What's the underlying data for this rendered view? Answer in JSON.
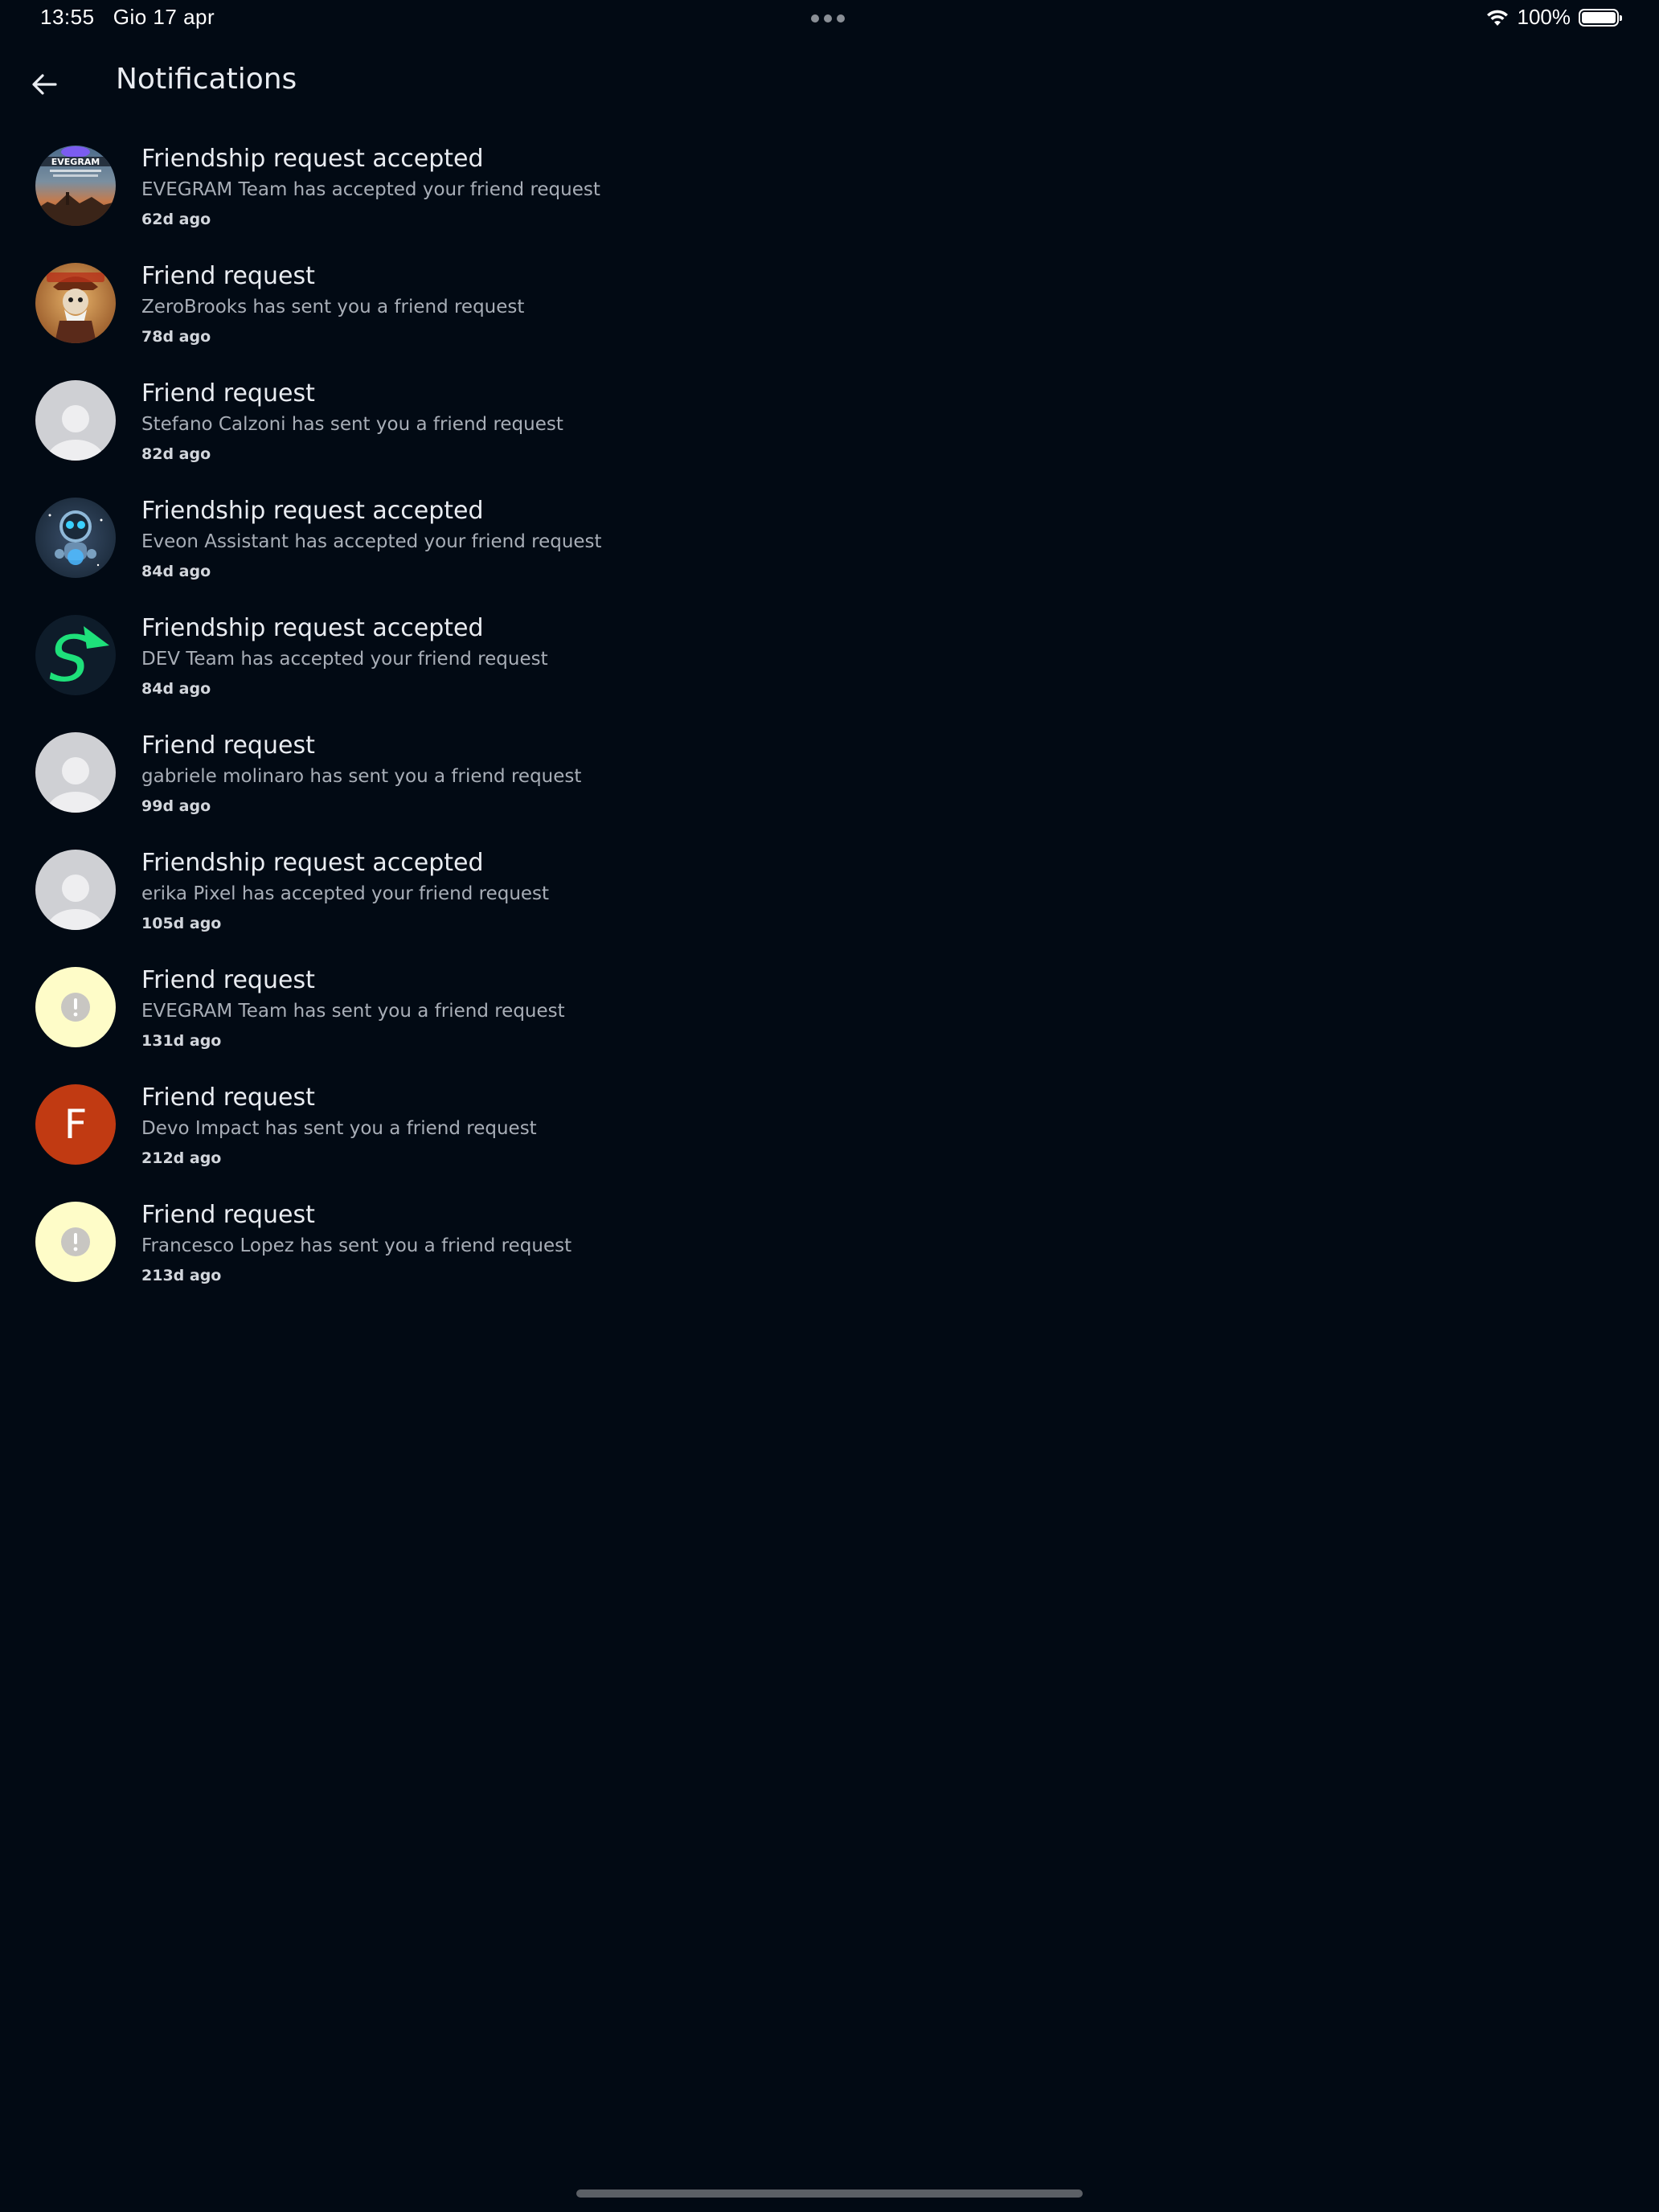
{
  "status_bar": {
    "time": "13:55",
    "date": "Gio 17 apr",
    "battery": "100%",
    "battery_level": 1.0,
    "icons": [
      "wifi-icon",
      "battery-icon",
      "multitasking-dots-icon"
    ]
  },
  "header": {
    "title": "Notifications",
    "back_icon": "arrow-left-icon"
  },
  "notifications": [
    {
      "title": "Friendship request accepted",
      "body": "EVEGRAM Team has accepted your friend request",
      "time": "62d ago",
      "avatar": "evegram-image",
      "avatar_text": "EVEGRAM"
    },
    {
      "title": "Friend request",
      "body": "ZeroBrooks has sent you a friend request",
      "time": "78d ago",
      "avatar": "character-image"
    },
    {
      "title": "Friend request",
      "body": "Stefano Calzoni has sent you a friend request",
      "time": "82d ago",
      "avatar": "default-user"
    },
    {
      "title": "Friendship request accepted",
      "body": "Eveon Assistant has accepted your friend request",
      "time": "84d ago",
      "avatar": "robot-image"
    },
    {
      "title": "Friendship request accepted",
      "body": "DEV Team has accepted your friend request",
      "time": "84d ago",
      "avatar": "s-logo",
      "avatar_text": "S"
    },
    {
      "title": "Friend request",
      "body": "gabriele molinaro has sent you a friend request",
      "time": "99d ago",
      "avatar": "default-user"
    },
    {
      "title": "Friendship request accepted",
      "body": "erika Pixel has accepted your friend request",
      "time": "105d ago",
      "avatar": "default-user"
    },
    {
      "title": "Friend request",
      "body": "EVEGRAM Team has sent you a friend request",
      "time": "131d ago",
      "avatar": "warning-placeholder"
    },
    {
      "title": "Friend request",
      "body": "Devo Impact has sent you a friend request",
      "time": "212d ago",
      "avatar": "letter",
      "avatar_text": "F"
    },
    {
      "title": "Friend request",
      "body": "Francesco Lopez has sent you a friend request",
      "time": "213d ago",
      "avatar": "warning-placeholder"
    }
  ],
  "colors": {
    "background": "#020a14",
    "title_text": "#e9ecf1",
    "body_text": "#a8aeb7",
    "default_avatar": "#cfd0d4",
    "warning_avatar": "#fefcc8",
    "letter_avatar": "#c13a12",
    "s_logo_green": "#1ee07a"
  }
}
